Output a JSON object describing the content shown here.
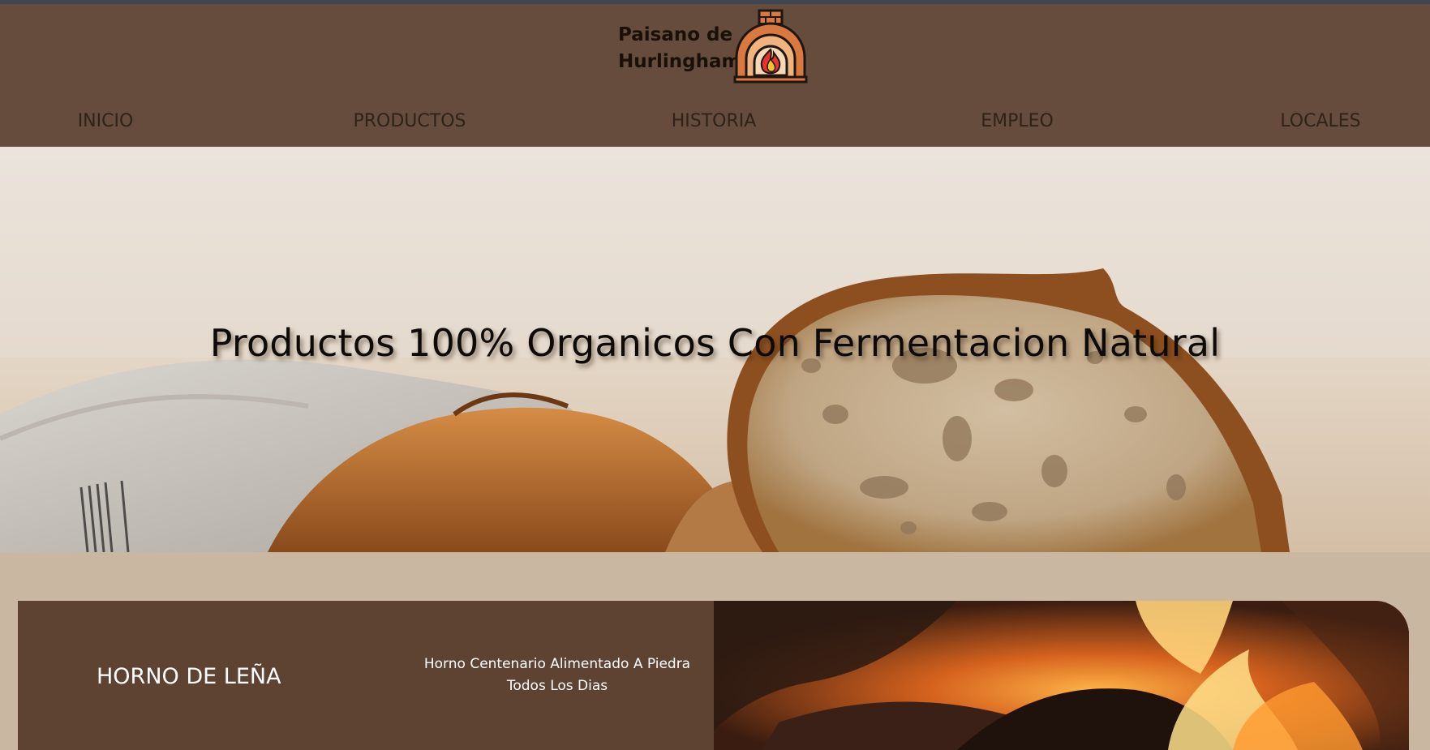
{
  "brand": {
    "name": "Paisano de\nHurlingham",
    "logo_icon": "brick-oven-icon"
  },
  "nav": {
    "items": [
      {
        "label": "INICIO"
      },
      {
        "label": "PRODUCTOS"
      },
      {
        "label": "HISTORIA"
      },
      {
        "label": "EMPLEO"
      },
      {
        "label": "LOCALES"
      }
    ]
  },
  "hero": {
    "title": "Productos 100% Organicos Con Fermentacion Natural"
  },
  "feature": {
    "title": "HORNO DE LEÑA",
    "description": "Horno Centenario Alimentado A Piedra Todos Los Dias"
  },
  "colors": {
    "header_bg": "#654c3c",
    "page_bg": "#c9b7a2",
    "feature_bg": "#5e4232",
    "top_bar": "#3d4552"
  }
}
